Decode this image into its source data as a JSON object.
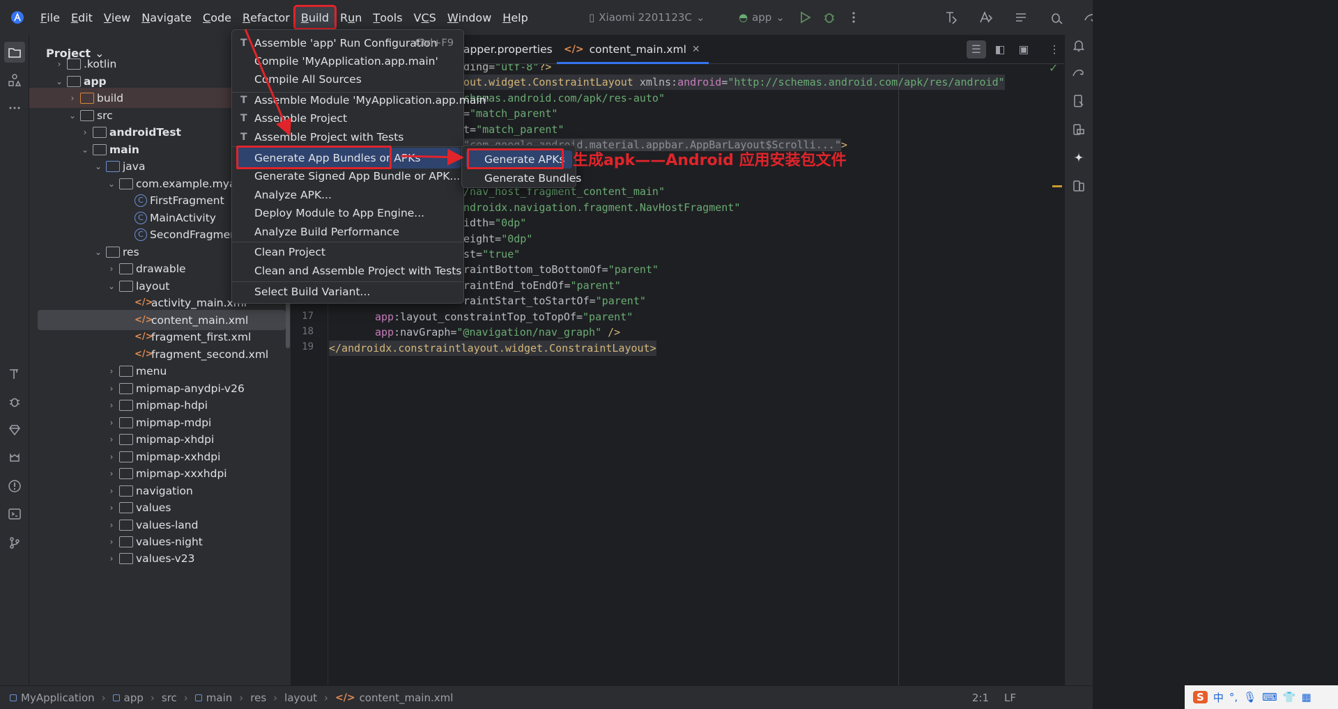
{
  "titlebar": {
    "menu": [
      "File",
      "Edit",
      "View",
      "Navigate",
      "Code",
      "Refactor",
      "Build",
      "Run",
      "Tools",
      "VCS",
      "Window",
      "Help"
    ],
    "device": "Xiaomi 2201123C",
    "run_config": "app"
  },
  "project_panel": {
    "title": "Project",
    "tree": [
      {
        "label": ".kotlin",
        "indent": 0
      },
      {
        "label": "app",
        "indent": 0
      },
      {
        "label": "build",
        "indent": 1
      },
      {
        "label": "src",
        "indent": 1
      },
      {
        "label": "androidTest",
        "indent": 2
      },
      {
        "label": "main",
        "indent": 2
      },
      {
        "label": "java",
        "indent": 3
      },
      {
        "label": "com.example.myapplica",
        "indent": 4
      },
      {
        "label": "FirstFragment",
        "indent": 5
      },
      {
        "label": "MainActivity",
        "indent": 5
      },
      {
        "label": "SecondFragment",
        "indent": 5
      },
      {
        "label": "res",
        "indent": 3
      },
      {
        "label": "drawable",
        "indent": 4
      },
      {
        "label": "layout",
        "indent": 4
      },
      {
        "label": "activity_main.xml",
        "indent": 5
      },
      {
        "label": "content_main.xml",
        "indent": 5
      },
      {
        "label": "fragment_first.xml",
        "indent": 5
      },
      {
        "label": "fragment_second.xml",
        "indent": 5
      },
      {
        "label": "menu",
        "indent": 4
      },
      {
        "label": "mipmap-anydpi-v26",
        "indent": 4
      },
      {
        "label": "mipmap-hdpi",
        "indent": 4
      },
      {
        "label": "mipmap-mdpi",
        "indent": 4
      },
      {
        "label": "mipmap-xhdpi",
        "indent": 4
      },
      {
        "label": "mipmap-xxhdpi",
        "indent": 4
      },
      {
        "label": "mipmap-xxxhdpi",
        "indent": 4
      },
      {
        "label": "navigation",
        "indent": 4
      },
      {
        "label": "values",
        "indent": 4
      },
      {
        "label": "values-land",
        "indent": 4
      },
      {
        "label": "values-night",
        "indent": 4
      },
      {
        "label": "values-v23",
        "indent": 4
      }
    ]
  },
  "editor": {
    "tabs": [
      "apper.properties",
      "content_main.xml"
    ],
    "line_numbers": [
      "17",
      "18",
      "19"
    ],
    "code_lines": [
      "ding=\"utf-8\"?>",
      "out.widget.ConstraintLayout xmlns:android=\"http://schemas.android.com/apk/res/android\"",
      "chemas.android.com/apk/res-auto\"",
      "=\"match_parent\"",
      "t=\"match_parent\"",
      "\"com.google.android.material.appbar.AppBarLayout$Scrolli...\">",
      "",
      "",
      "/nav_host_fragment_content_main\"",
      "ndroidx.navigation.fragment.NavHostFragment\"",
      "idth=\"0dp\"",
      "eight=\"0dp\"",
      "st=\"true\"",
      "raintBottom_toBottomOf=\"parent\"",
      "raintEnd_toEndOf=\"parent\"",
      "raintStart_toStartOf=\"parent\"",
      "    app:layout_constraintTop_toTopOf=\"parent\"",
      "    app:navGraph=\"@navigation/nav_graph\" />",
      "</androidx.constraintlayout.widget.ConstraintLayout>"
    ]
  },
  "build_menu": {
    "items": [
      {
        "label": "Assemble 'app' Run Configuration",
        "shortcut": "Ctrl+F9"
      },
      {
        "label": "Compile 'MyApplication.app.main'",
        "shortcut": ""
      },
      {
        "label": "Compile All Sources",
        "shortcut": ""
      },
      {
        "label": "Assemble Module 'MyApplication.app.main'",
        "shortcut": ""
      },
      {
        "label": "Assemble Project",
        "shortcut": ""
      },
      {
        "label": "Assemble Project with Tests",
        "shortcut": ""
      },
      {
        "label": "Generate App Bundles or APKs",
        "shortcut": ""
      },
      {
        "label": "Generate Signed App Bundle or APK...",
        "shortcut": ""
      },
      {
        "label": "Analyze APK...",
        "shortcut": ""
      },
      {
        "label": "Deploy Module to App Engine...",
        "shortcut": ""
      },
      {
        "label": "Analyze Build Performance",
        "shortcut": ""
      },
      {
        "label": "Clean Project",
        "shortcut": ""
      },
      {
        "label": "Clean and Assemble Project with Tests",
        "shortcut": ""
      },
      {
        "label": "Select Build Variant...",
        "shortcut": ""
      }
    ],
    "submenu": [
      "Generate APKs",
      "Generate Bundles"
    ]
  },
  "annotation": "生成apk——Android 应用安装包文件",
  "statusbar": {
    "breadcrumbs": [
      "MyApplication",
      "app",
      "src",
      "main",
      "res",
      "layout",
      "content_main.xml"
    ],
    "position": "2:1",
    "line_sep": "LF",
    "ime": "中"
  },
  "colors": {
    "accent": "#3574f0",
    "annotation_red": "#e0242b",
    "menu_selection": "#2e436e"
  }
}
